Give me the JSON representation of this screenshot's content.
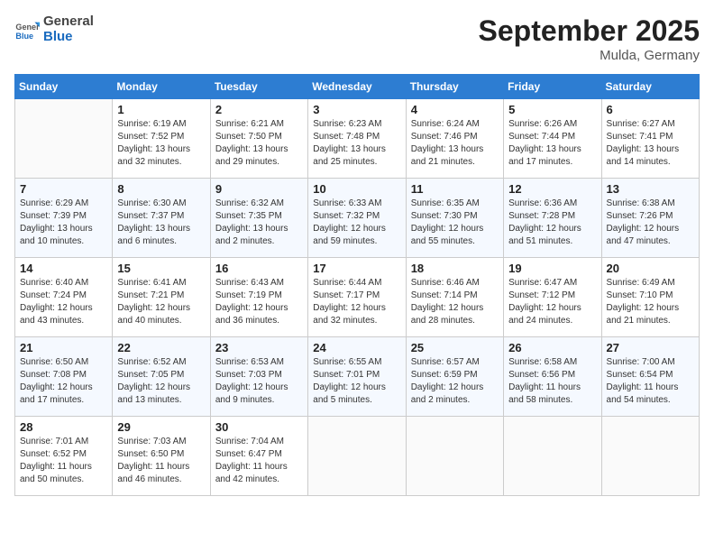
{
  "header": {
    "logo_general": "General",
    "logo_blue": "Blue",
    "month_title": "September 2025",
    "location": "Mulda, Germany"
  },
  "days_of_week": [
    "Sunday",
    "Monday",
    "Tuesday",
    "Wednesday",
    "Thursday",
    "Friday",
    "Saturday"
  ],
  "weeks": [
    [
      {
        "empty": true
      },
      {
        "day": "1",
        "sunrise": "6:19 AM",
        "sunset": "7:52 PM",
        "daylight": "13 hours and 32 minutes."
      },
      {
        "day": "2",
        "sunrise": "6:21 AM",
        "sunset": "7:50 PM",
        "daylight": "13 hours and 29 minutes."
      },
      {
        "day": "3",
        "sunrise": "6:23 AM",
        "sunset": "7:48 PM",
        "daylight": "13 hours and 25 minutes."
      },
      {
        "day": "4",
        "sunrise": "6:24 AM",
        "sunset": "7:46 PM",
        "daylight": "13 hours and 21 minutes."
      },
      {
        "day": "5",
        "sunrise": "6:26 AM",
        "sunset": "7:44 PM",
        "daylight": "13 hours and 17 minutes."
      },
      {
        "day": "6",
        "sunrise": "6:27 AM",
        "sunset": "7:41 PM",
        "daylight": "13 hours and 14 minutes."
      }
    ],
    [
      {
        "day": "7",
        "sunrise": "6:29 AM",
        "sunset": "7:39 PM",
        "daylight": "13 hours and 10 minutes."
      },
      {
        "day": "8",
        "sunrise": "6:30 AM",
        "sunset": "7:37 PM",
        "daylight": "13 hours and 6 minutes."
      },
      {
        "day": "9",
        "sunrise": "6:32 AM",
        "sunset": "7:35 PM",
        "daylight": "13 hours and 2 minutes."
      },
      {
        "day": "10",
        "sunrise": "6:33 AM",
        "sunset": "7:32 PM",
        "daylight": "12 hours and 59 minutes."
      },
      {
        "day": "11",
        "sunrise": "6:35 AM",
        "sunset": "7:30 PM",
        "daylight": "12 hours and 55 minutes."
      },
      {
        "day": "12",
        "sunrise": "6:36 AM",
        "sunset": "7:28 PM",
        "daylight": "12 hours and 51 minutes."
      },
      {
        "day": "13",
        "sunrise": "6:38 AM",
        "sunset": "7:26 PM",
        "daylight": "12 hours and 47 minutes."
      }
    ],
    [
      {
        "day": "14",
        "sunrise": "6:40 AM",
        "sunset": "7:24 PM",
        "daylight": "12 hours and 43 minutes."
      },
      {
        "day": "15",
        "sunrise": "6:41 AM",
        "sunset": "7:21 PM",
        "daylight": "12 hours and 40 minutes."
      },
      {
        "day": "16",
        "sunrise": "6:43 AM",
        "sunset": "7:19 PM",
        "daylight": "12 hours and 36 minutes."
      },
      {
        "day": "17",
        "sunrise": "6:44 AM",
        "sunset": "7:17 PM",
        "daylight": "12 hours and 32 minutes."
      },
      {
        "day": "18",
        "sunrise": "6:46 AM",
        "sunset": "7:14 PM",
        "daylight": "12 hours and 28 minutes."
      },
      {
        "day": "19",
        "sunrise": "6:47 AM",
        "sunset": "7:12 PM",
        "daylight": "12 hours and 24 minutes."
      },
      {
        "day": "20",
        "sunrise": "6:49 AM",
        "sunset": "7:10 PM",
        "daylight": "12 hours and 21 minutes."
      }
    ],
    [
      {
        "day": "21",
        "sunrise": "6:50 AM",
        "sunset": "7:08 PM",
        "daylight": "12 hours and 17 minutes."
      },
      {
        "day": "22",
        "sunrise": "6:52 AM",
        "sunset": "7:05 PM",
        "daylight": "12 hours and 13 minutes."
      },
      {
        "day": "23",
        "sunrise": "6:53 AM",
        "sunset": "7:03 PM",
        "daylight": "12 hours and 9 minutes."
      },
      {
        "day": "24",
        "sunrise": "6:55 AM",
        "sunset": "7:01 PM",
        "daylight": "12 hours and 5 minutes."
      },
      {
        "day": "25",
        "sunrise": "6:57 AM",
        "sunset": "6:59 PM",
        "daylight": "12 hours and 2 minutes."
      },
      {
        "day": "26",
        "sunrise": "6:58 AM",
        "sunset": "6:56 PM",
        "daylight": "11 hours and 58 minutes."
      },
      {
        "day": "27",
        "sunrise": "7:00 AM",
        "sunset": "6:54 PM",
        "daylight": "11 hours and 54 minutes."
      }
    ],
    [
      {
        "day": "28",
        "sunrise": "7:01 AM",
        "sunset": "6:52 PM",
        "daylight": "11 hours and 50 minutes."
      },
      {
        "day": "29",
        "sunrise": "7:03 AM",
        "sunset": "6:50 PM",
        "daylight": "11 hours and 46 minutes."
      },
      {
        "day": "30",
        "sunrise": "7:04 AM",
        "sunset": "6:47 PM",
        "daylight": "11 hours and 42 minutes."
      },
      {
        "empty": true
      },
      {
        "empty": true
      },
      {
        "empty": true
      },
      {
        "empty": true
      }
    ]
  ],
  "labels": {
    "sunrise": "Sunrise:",
    "sunset": "Sunset:",
    "daylight": "Daylight:"
  }
}
